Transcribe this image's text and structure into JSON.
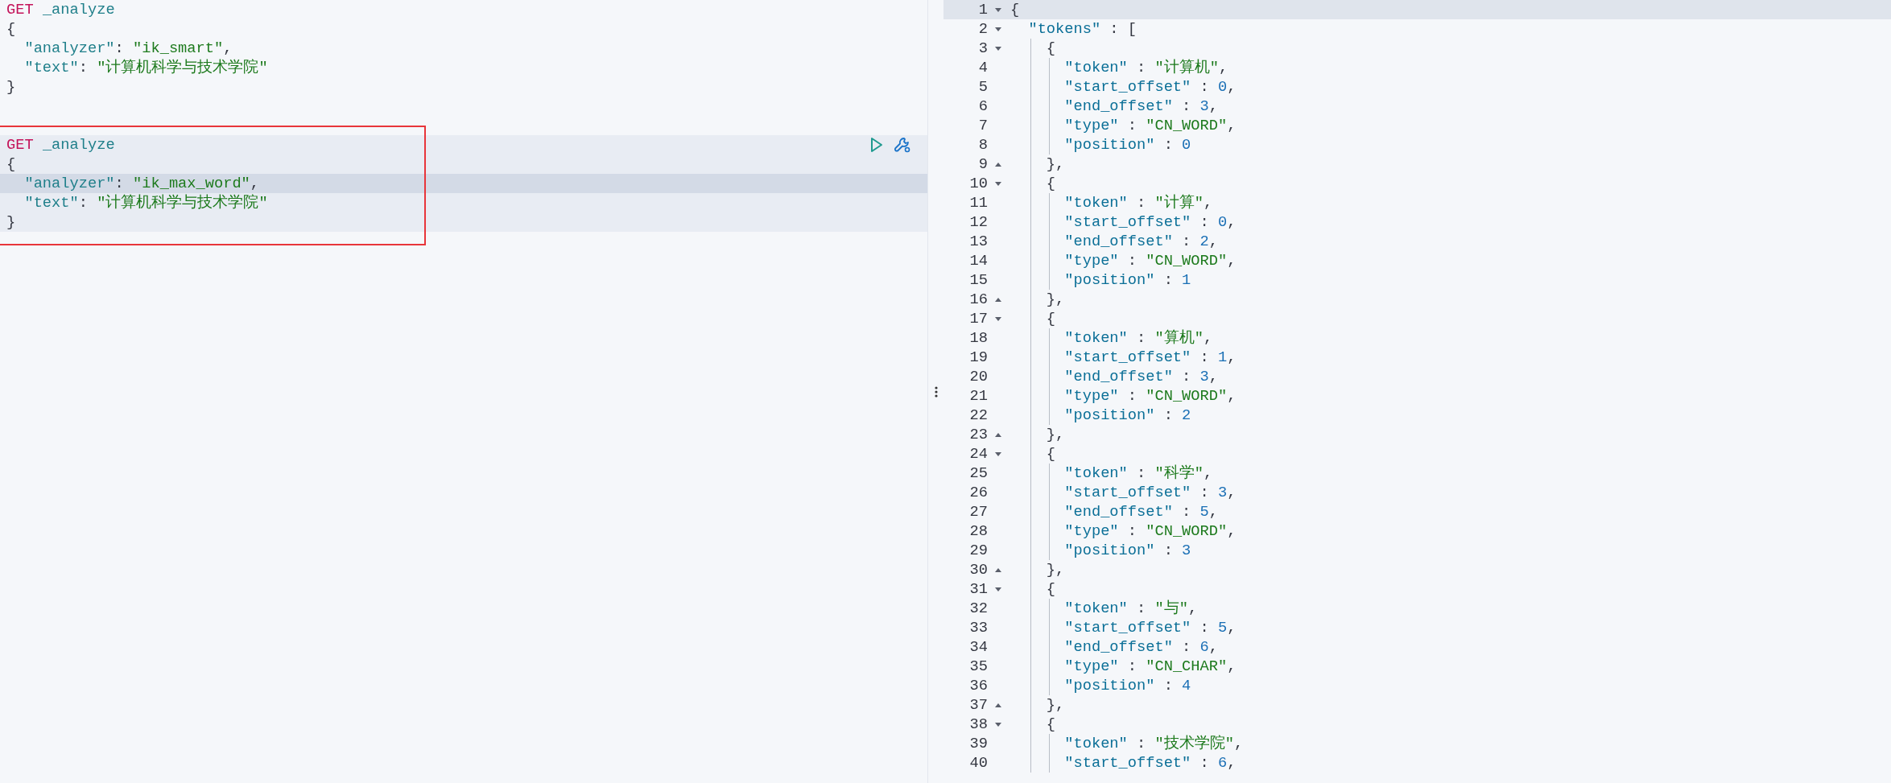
{
  "left_editor": {
    "requests": [
      {
        "method": "GET",
        "path": "_analyze",
        "selected": false,
        "annotated": false,
        "lines": [
          {
            "text": "{",
            "active": false
          },
          {
            "text": "  \"analyzer\": \"ik_smart\",",
            "active": false
          },
          {
            "text": "  \"text\": \"计算机科学与技术学院\"",
            "active": false
          },
          {
            "text": "}",
            "active": false
          }
        ]
      },
      {
        "method": "GET",
        "path": "_analyze",
        "selected": true,
        "annotated": true,
        "lines": [
          {
            "text": "{",
            "active": false
          },
          {
            "text": "  \"analyzer\": \"ik_max_word\",",
            "active": true
          },
          {
            "text": "  \"text\": \"计算机科学与技术学院\"",
            "active": false
          },
          {
            "text": "}",
            "active": false
          }
        ]
      }
    ]
  },
  "response": {
    "lines": [
      {
        "n": "1",
        "text": "{",
        "expanded": true,
        "active": true
      },
      {
        "n": "2",
        "text": "  \"tokens\" : [",
        "expanded": true,
        "active": false
      },
      {
        "n": "3",
        "text": "    {",
        "expanded": true,
        "active": false
      },
      {
        "n": "4",
        "text": "      \"token\" : \"计算机\",",
        "active": false
      },
      {
        "n": "5",
        "text": "      \"start_offset\" : 0,",
        "active": false
      },
      {
        "n": "6",
        "text": "      \"end_offset\" : 3,",
        "active": false
      },
      {
        "n": "7",
        "text": "      \"type\" : \"CN_WORD\",",
        "active": false
      },
      {
        "n": "8",
        "text": "      \"position\" : 0",
        "active": false
      },
      {
        "n": "9",
        "text": "    },",
        "fold_end": true,
        "active": false
      },
      {
        "n": "10",
        "text": "    {",
        "expanded": true,
        "active": false
      },
      {
        "n": "11",
        "text": "      \"token\" : \"计算\",",
        "active": false
      },
      {
        "n": "12",
        "text": "      \"start_offset\" : 0,",
        "active": false
      },
      {
        "n": "13",
        "text": "      \"end_offset\" : 2,",
        "active": false
      },
      {
        "n": "14",
        "text": "      \"type\" : \"CN_WORD\",",
        "active": false
      },
      {
        "n": "15",
        "text": "      \"position\" : 1",
        "active": false
      },
      {
        "n": "16",
        "text": "    },",
        "fold_end": true,
        "active": false
      },
      {
        "n": "17",
        "text": "    {",
        "expanded": true,
        "active": false
      },
      {
        "n": "18",
        "text": "      \"token\" : \"算机\",",
        "active": false
      },
      {
        "n": "19",
        "text": "      \"start_offset\" : 1,",
        "active": false
      },
      {
        "n": "20",
        "text": "      \"end_offset\" : 3,",
        "active": false
      },
      {
        "n": "21",
        "text": "      \"type\" : \"CN_WORD\",",
        "active": false
      },
      {
        "n": "22",
        "text": "      \"position\" : 2",
        "active": false
      },
      {
        "n": "23",
        "text": "    },",
        "fold_end": true,
        "active": false
      },
      {
        "n": "24",
        "text": "    {",
        "expanded": true,
        "active": false
      },
      {
        "n": "25",
        "text": "      \"token\" : \"科学\",",
        "active": false
      },
      {
        "n": "26",
        "text": "      \"start_offset\" : 3,",
        "active": false
      },
      {
        "n": "27",
        "text": "      \"end_offset\" : 5,",
        "active": false
      },
      {
        "n": "28",
        "text": "      \"type\" : \"CN_WORD\",",
        "active": false
      },
      {
        "n": "29",
        "text": "      \"position\" : 3",
        "active": false
      },
      {
        "n": "30",
        "text": "    },",
        "fold_end": true,
        "active": false
      },
      {
        "n": "31",
        "text": "    {",
        "expanded": true,
        "active": false
      },
      {
        "n": "32",
        "text": "      \"token\" : \"与\",",
        "active": false
      },
      {
        "n": "33",
        "text": "      \"start_offset\" : 5,",
        "active": false
      },
      {
        "n": "34",
        "text": "      \"end_offset\" : 6,",
        "active": false
      },
      {
        "n": "35",
        "text": "      \"type\" : \"CN_CHAR\",",
        "active": false
      },
      {
        "n": "36",
        "text": "      \"position\" : 4",
        "active": false
      },
      {
        "n": "37",
        "text": "    },",
        "fold_end": true,
        "active": false
      },
      {
        "n": "38",
        "text": "    {",
        "expanded": true,
        "active": false
      },
      {
        "n": "39",
        "text": "      \"token\" : \"技术学院\",",
        "active": false
      },
      {
        "n": "40",
        "text": "      \"start_offset\" : 6,",
        "active": false
      }
    ]
  }
}
